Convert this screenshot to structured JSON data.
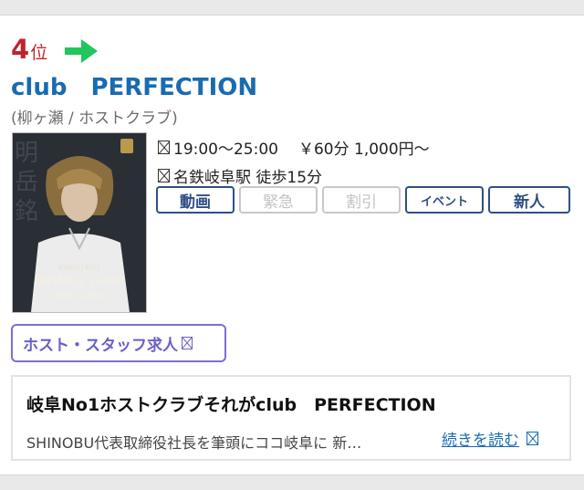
{
  "listing": {
    "rank_number": "4",
    "rank_suffix": "位",
    "rank_arrow_icon": "right-arrow-icon",
    "rank_arrow_color": "#22c55e",
    "club_name": "club　PERFECTION",
    "area_label": "(柳ヶ瀬 / ホストクラブ)",
    "thumbnail": {
      "overlay_name": "KIMOU KYO",
      "overlay_event": "Birthday Event",
      "overlay_date": "2025.3.23sun"
    },
    "hours_icon": "clock-icon",
    "hours": "19:00〜25:00",
    "price": "￥60分 1,000円〜",
    "station_icon": "train-icon",
    "station": "名鉄岐阜駅 徒歩15分",
    "tags": {
      "video": "動画",
      "urgent": "緊急",
      "discount": "割引",
      "event": "イベント",
      "newcomer": "新人"
    },
    "recruit_button": "ホスト・スタッフ求人",
    "recruit_icon": "external-link-icon",
    "pr": {
      "title": "岐阜No1ホストクラブそれがclub　PERFECTION",
      "text": "SHINOBU代表取締役社長を筆頭にココ岐阜に 新…",
      "read_more": "続きを読む",
      "read_more_icon": "external-link-icon"
    }
  },
  "colors": {
    "rank": "#c0242b",
    "club_name": "#1a6bb0",
    "tag_border": "#2f4f86",
    "recruit": "#6a60c8"
  }
}
